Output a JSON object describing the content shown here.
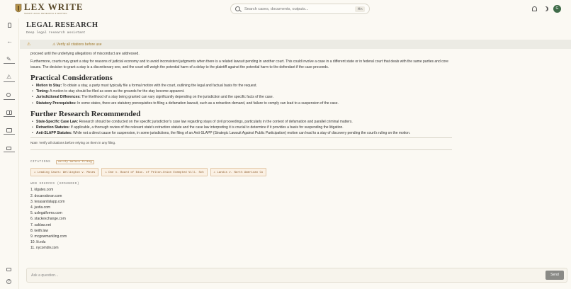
{
  "app": {
    "logo_text": "LEX WRITE",
    "logo_sub": "SMART LEGAL RESEARCH & WRITING"
  },
  "search": {
    "placeholder": "Search cases, documents, outputs...",
    "shortcut": "⌘K"
  },
  "user": {
    "avatar": "G"
  },
  "header": {
    "title": "LEGAL RESEARCH",
    "subtitle": "Deep legal research assistant"
  },
  "banner": {
    "text": "⚠ Verify all citations before use"
  },
  "content": {
    "p1": "proceed until the underlying allegations of misconduct are addressed.",
    "p2": "Furthermore, courts may grant a stay for reasons of judicial economy and to avoid inconsistent judgments when there is a related lawsuit pending in another court. This could involve a case in a different state or in federal court that deals with the same parties and core issues. The decision to grant a stay is a discretionary one, and the court will weigh the potential harm of a delay to the plaintiff against the potential harm to the defendant if the case proceeds.",
    "h_practical": "Practical Considerations",
    "practical": [
      {
        "term": "Motion to Stay:",
        "text": " To obtain a stay, a party must typically file a formal motion with the court, outlining the legal and factual basis for the request."
      },
      {
        "term": "Timing:",
        "text": " A motion to stay should be filed as soon as the grounds for the stay become apparent."
      },
      {
        "term": "Jurisdictional Differences:",
        "text": " The likelihood of a stay being granted can vary significantly depending on the jurisdiction and the specific facts of the case."
      },
      {
        "term": "Statutory Prerequisites:",
        "text": " In some states, there are statutory prerequisites to filing a defamation lawsuit, such as a retraction demand, and failure to comply can lead to a suspension of the case."
      }
    ],
    "h_further": "Further Research Recommended",
    "further": [
      {
        "term": "State-Specific Case Law:",
        "text": " Research should be conducted on the specific jurisdiction's case law regarding stays of civil proceedings, particularly in the context of defamation and parallel criminal matters."
      },
      {
        "term": "Retraction Statutes:",
        "text": " If applicable, a thorough review of the relevant state's retraction statute and the case law interpreting it is crucial to determine if it provides a basis for suspending the litigation."
      },
      {
        "term": "Anti-SLAPP Statutes:",
        "text": " While not a direct cause for suspension, in some jurisdictions, the filing of an Anti-SLAPP (Strategic Lawsuit Against Public Participation) motion can lead to a stay of discovery pending the court's ruling on the motion."
      }
    ],
    "note": "Note: Verify all citations before relying on them in any filing."
  },
  "citations": {
    "label": "CITATIONS",
    "badge": "verify before filing",
    "items": [
      "⚠ Leading Cases: Wellington v. Moses",
      "⚠ Doe v. Board of Educ. of Pelton-Union Exempted Vill. Sch",
      "⚠ Landis v. North American Co"
    ]
  },
  "web_sources": {
    "label": "WEB SOURCES (GROUNDED)",
    "items": [
      "1. klgates.com",
      "2. docarodoran.com",
      "3. texasantislapp.com",
      "4. justia.com",
      "5. uslegalforms.com",
      "6. stackexchange.com",
      "7. saklaw.net",
      "8. keith.law",
      "9. mcgowmarkling.com",
      "10. lii.edu",
      "11. nycomdiv.com"
    ]
  },
  "composer": {
    "placeholder": "Ask a question...",
    "send_label": "Send"
  }
}
